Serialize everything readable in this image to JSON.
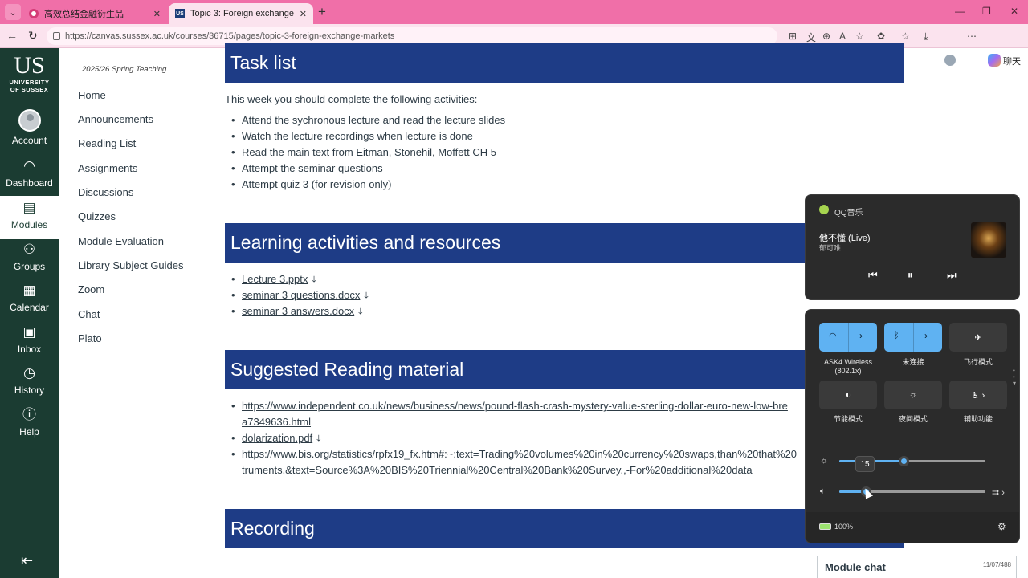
{
  "browser": {
    "tabs": [
      {
        "title": "高效总结金融衍生品"
      },
      {
        "title": "Topic 3: Foreign exchange markets"
      }
    ],
    "url": "https://canvas.sussex.ac.uk/courses/36715/pages/topic-3-foreign-exchange-markets",
    "chat_label": "聊天"
  },
  "global_nav": {
    "logo_big": "US",
    "logo_line1": "UNIVERSITY",
    "logo_line2": "OF SUSSEX",
    "items": [
      {
        "label": "Account"
      },
      {
        "label": "Dashboard"
      },
      {
        "label": "Modules"
      },
      {
        "label": "Groups"
      },
      {
        "label": "Calendar"
      },
      {
        "label": "Inbox"
      },
      {
        "label": "History"
      },
      {
        "label": "Help"
      }
    ]
  },
  "course_nav": {
    "term": "2025/26 Spring Teaching",
    "links": [
      "Home",
      "Announcements",
      "Reading List",
      "Assignments",
      "Discussions",
      "Quizzes",
      "Module Evaluation",
      "Library Subject Guides",
      "Zoom",
      "Chat",
      "Plato"
    ]
  },
  "content": {
    "task_list": {
      "heading": "Task list",
      "intro": "This week you should complete the following activities:",
      "items": [
        "Attend the sychronous lecture and read the lecture slides",
        "Watch the lecture recordings when lecture is done",
        "Read the main text from  Eitman, Stonehil, Moffett CH 5",
        "Attempt the seminar questions",
        "Attempt quiz 3 (for revision only)"
      ]
    },
    "activities": {
      "heading": "Learning activities and resources",
      "files": [
        "Lecture 3.pptx",
        "seminar 3 questions.docx",
        "seminar 3 answers.docx"
      ]
    },
    "reading": {
      "heading": "Suggested Reading material",
      "link1": "https://www.independent.co.uk/news/business/news/pound-flash-crash-mystery-value-sterling-dollar-euro-new-low-bre",
      "link1_cont": "a7349636.html",
      "link2": "dolarization.pdf",
      "link3": "https://www.bis.org/statistics/rpfx19_fx.htm#:~:text=Trading%20volumes%20in%20currency%20swaps,than%20that%20",
      "link3_cont": "truments.&text=Source%3A%20BIS%20Triennial%20Central%20Bank%20Survey.,-For%20additional%20data"
    },
    "recording": {
      "heading": "Recording"
    }
  },
  "media": {
    "app_name": "QQ音乐",
    "song": "他不懂 (Live)",
    "artist": "郁可唯"
  },
  "quick_settings": {
    "tiles": [
      {
        "label": "ASK4 Wireless\n(802.1x)"
      },
      {
        "label": "未连接"
      },
      {
        "label": "飞行模式"
      },
      {
        "label": "节能模式"
      },
      {
        "label": "夜间模式"
      },
      {
        "label": "辅助功能"
      }
    ],
    "brightness_level": 0.44,
    "volume_value": "15",
    "volume_level": 0.18,
    "battery": "100%"
  },
  "module_chat": {
    "title": "Module chat",
    "count": "11/07/488"
  }
}
